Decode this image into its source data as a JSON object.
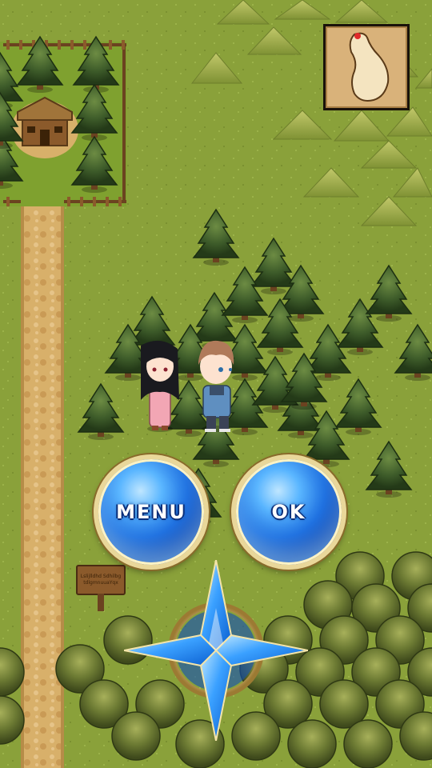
{
  "scene": {
    "type": "rpg-overworld",
    "colors": {
      "grass": "#8aa13a",
      "path": "#d8b06a",
      "tree_dark": "#2f4a22",
      "tree_light": "#5f7d3b",
      "hill": "#9bb04a",
      "fence": "#6b4220"
    }
  },
  "hud": {
    "menu_label": "MENU",
    "ok_label": "OK",
    "dpad_icon": "compass-star-dpad",
    "minimap_icon": "parchment-map-icon"
  },
  "signpost": {
    "line1": "Lslijlldhd Sdhilbg",
    "line2": "tdlgmnuuaYqx"
  },
  "characters": [
    {
      "name": "girl-pink-dress",
      "icon": "girl-sprite"
    },
    {
      "name": "boy-blue-jacket",
      "icon": "boy-sprite"
    }
  ]
}
